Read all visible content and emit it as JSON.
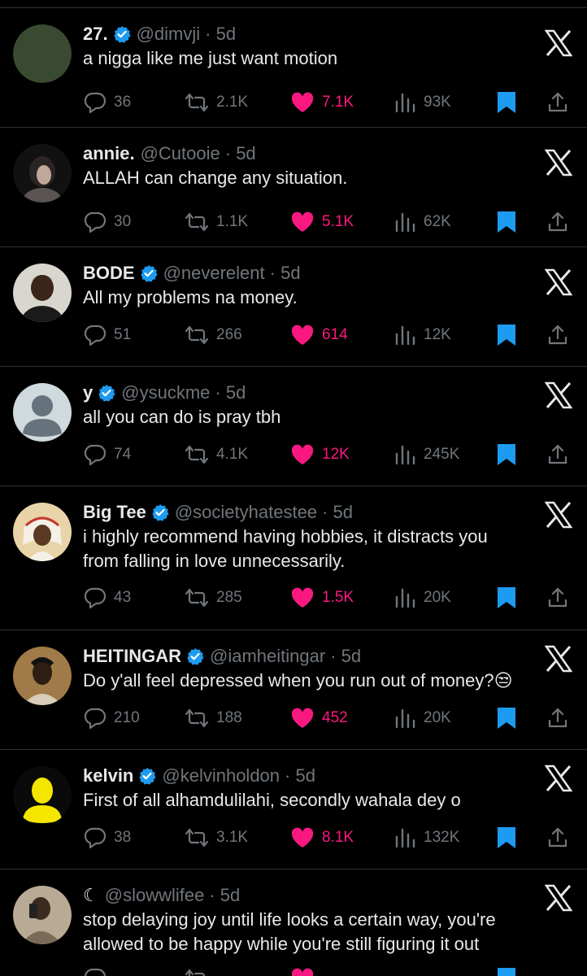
{
  "colors": {
    "background": "#000000",
    "text": "#e7e9ea",
    "muted": "#71767b",
    "like": "#f91880",
    "verified": "#1d9bf0",
    "bookmark": "#1d9bf0",
    "divider": "#2f3336"
  },
  "tweets": [
    {
      "name": "27.",
      "verified": true,
      "handle": "@dimvji",
      "time": "· 5d",
      "text": [
        "a nigga like me just want motion"
      ],
      "replies": "36",
      "retweets": "2.1K",
      "likes": "7.1K",
      "views": "93K",
      "avatar": "solid-dark-green"
    },
    {
      "name": "annie.",
      "verified": false,
      "handle": "@Cutooie",
      "time": "· 5d",
      "text": [
        "ALLAH can change any situation."
      ],
      "replies": "30",
      "retweets": "1.1K",
      "likes": "5.1K",
      "views": "62K",
      "avatar": "photo"
    },
    {
      "name": "BODE",
      "verified": true,
      "handle": "@neverelent",
      "time": "· 5d",
      "text": [
        "All my problems na money."
      ],
      "replies": "51",
      "retweets": "266",
      "likes": "614",
      "views": "12K",
      "avatar": "photo"
    },
    {
      "name": "y",
      "verified": true,
      "handle": "@ysuckme",
      "time": "· 5d",
      "text": [
        "all you can do is pray tbh"
      ],
      "replies": "74",
      "retweets": "4.1K",
      "likes": "12K",
      "views": "245K",
      "avatar": "default-silhouette"
    },
    {
      "name": "Big Tee",
      "verified": true,
      "handle": "@societyhatestee",
      "time": "· 5d",
      "text": [
        "i highly recommend having hobbies, it distracts you",
        "from falling in love unnecessarily."
      ],
      "replies": "43",
      "retweets": "285",
      "likes": "1.5K",
      "views": "20K",
      "avatar": "illustration"
    },
    {
      "name": "HEITINGAR",
      "verified": true,
      "handle": "@iamheitingar",
      "time": "· 5d",
      "text": [
        "Do y'all feel depressed when you run out of money?😒"
      ],
      "replies": "210",
      "retweets": "188",
      "likes": "452",
      "views": "20K",
      "avatar": "photo"
    },
    {
      "name": "kelvin",
      "verified": true,
      "handle": "@kelvinholdon",
      "time": "· 5d",
      "text": [
        "First of all alhamdulilahi, secondly wahala dey o"
      ],
      "replies": "38",
      "retweets": "3.1K",
      "likes": "8.1K",
      "views": "132K",
      "avatar": "yellow-silhouette"
    },
    {
      "name": "☾",
      "verified": false,
      "handle": "@slowwlifee",
      "time": "· 5d",
      "text": [
        "stop delaying joy until life looks a certain way, you're",
        "allowed to be happy while you're still figuring it out"
      ],
      "replies": "",
      "retweets": "",
      "likes": "",
      "views": "",
      "avatar": "photo"
    }
  ]
}
